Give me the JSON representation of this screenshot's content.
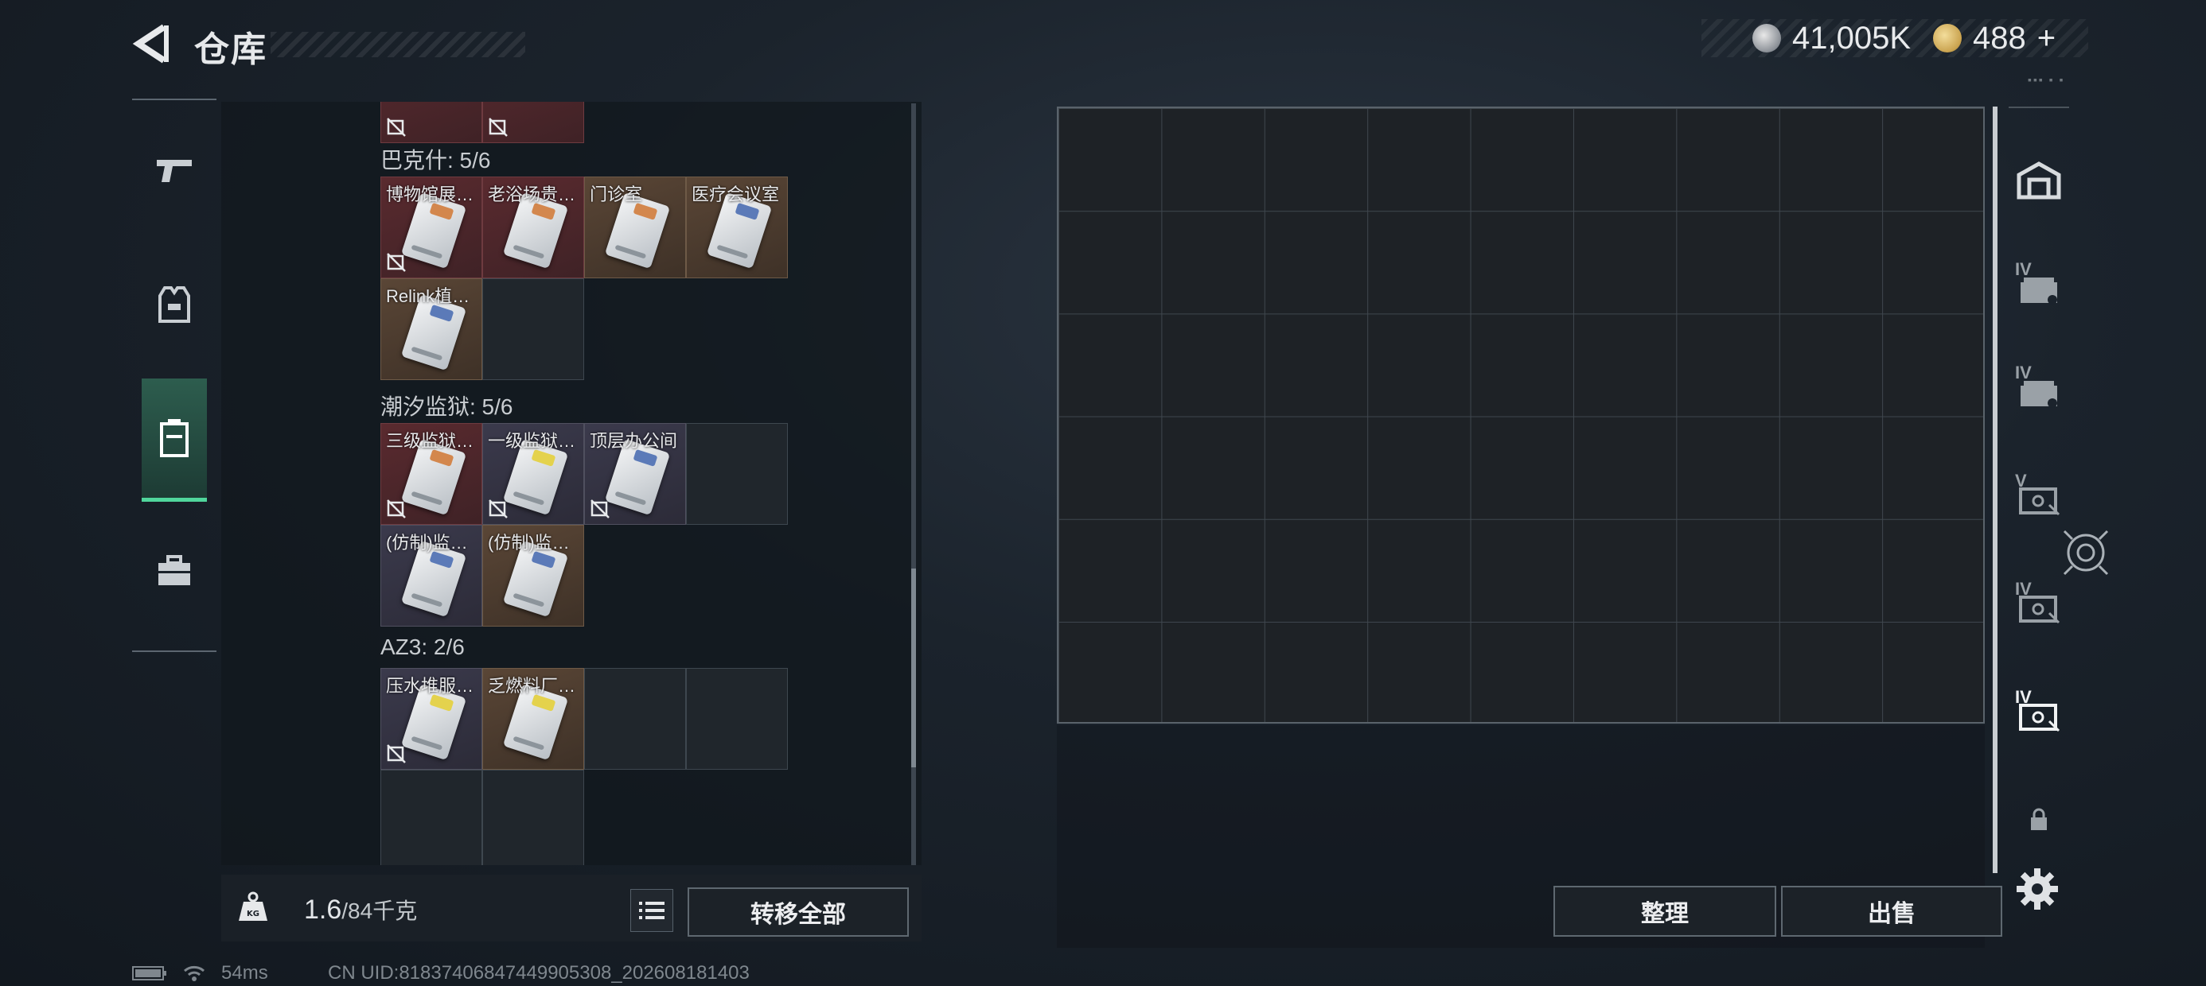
{
  "header": {
    "title": "仓库",
    "currency_silver": "41,005K",
    "currency_gold": "488",
    "currency_plus": "+"
  },
  "left_nav": {
    "items": [
      {
        "name": "weapons",
        "icon": "pistol-icon"
      },
      {
        "name": "equipment",
        "icon": "vest-icon"
      },
      {
        "name": "containers",
        "icon": "container-icon",
        "active": true
      },
      {
        "name": "supplies",
        "icon": "briefcase-icon"
      }
    ]
  },
  "left_panel": {
    "groups": [
      {
        "title": "巴克什: 5/6",
        "items": [
          {
            "label": "博物馆展…",
            "color": "red",
            "no_drop": true
          },
          {
            "label": "老浴场贵…",
            "color": "red",
            "no_drop": false
          },
          {
            "label": "门诊室",
            "color": "brown",
            "no_drop": false
          },
          {
            "label": "医疗会议室",
            "color": "brown",
            "no_drop": false
          },
          {
            "label": "Relink植…",
            "color": "brown",
            "no_drop": false
          }
        ]
      },
      {
        "title": "潮汐监狱: 5/6",
        "items": [
          {
            "label": "三级监狱…",
            "color": "red",
            "no_drop": true
          },
          {
            "label": "一级监狱…",
            "color": "purple",
            "no_drop": true
          },
          {
            "label": "顶层办公间",
            "color": "purple",
            "no_drop": true
          },
          {
            "label": "(仿制)监…",
            "color": "purple",
            "no_drop": false
          },
          {
            "label": "(仿制)监…",
            "color": "brown",
            "no_drop": false
          }
        ]
      },
      {
        "title": "AZ3: 2/6",
        "items": [
          {
            "label": "压水堆服…",
            "color": "purple",
            "no_drop": true
          },
          {
            "label": "乏燃料厂…",
            "color": "brown",
            "no_drop": false
          }
        ]
      }
    ]
  },
  "left_footer": {
    "weight_current": "1.6",
    "weight_max": "/84千克",
    "transfer_all": "转移全部"
  },
  "right_panel": {
    "sort_label": "整理",
    "sell_label": "出售",
    "container_list": [
      {
        "tier": "",
        "icon": "safe-box-icon"
      },
      {
        "tier": "IV",
        "icon": "keycard-case-icon"
      },
      {
        "tier": "IV",
        "icon": "keycard-case-icon"
      },
      {
        "tier": "V",
        "icon": "card-holder-icon"
      },
      {
        "tier": "IV",
        "icon": "card-holder-icon"
      },
      {
        "tier": "IV",
        "icon": "card-holder-icon",
        "active": true
      },
      {
        "tier": "",
        "icon": "lock-icon"
      }
    ]
  },
  "status_bar": {
    "ping": "54ms",
    "uid": "CN UID:81837406847449905308_202608181403"
  }
}
